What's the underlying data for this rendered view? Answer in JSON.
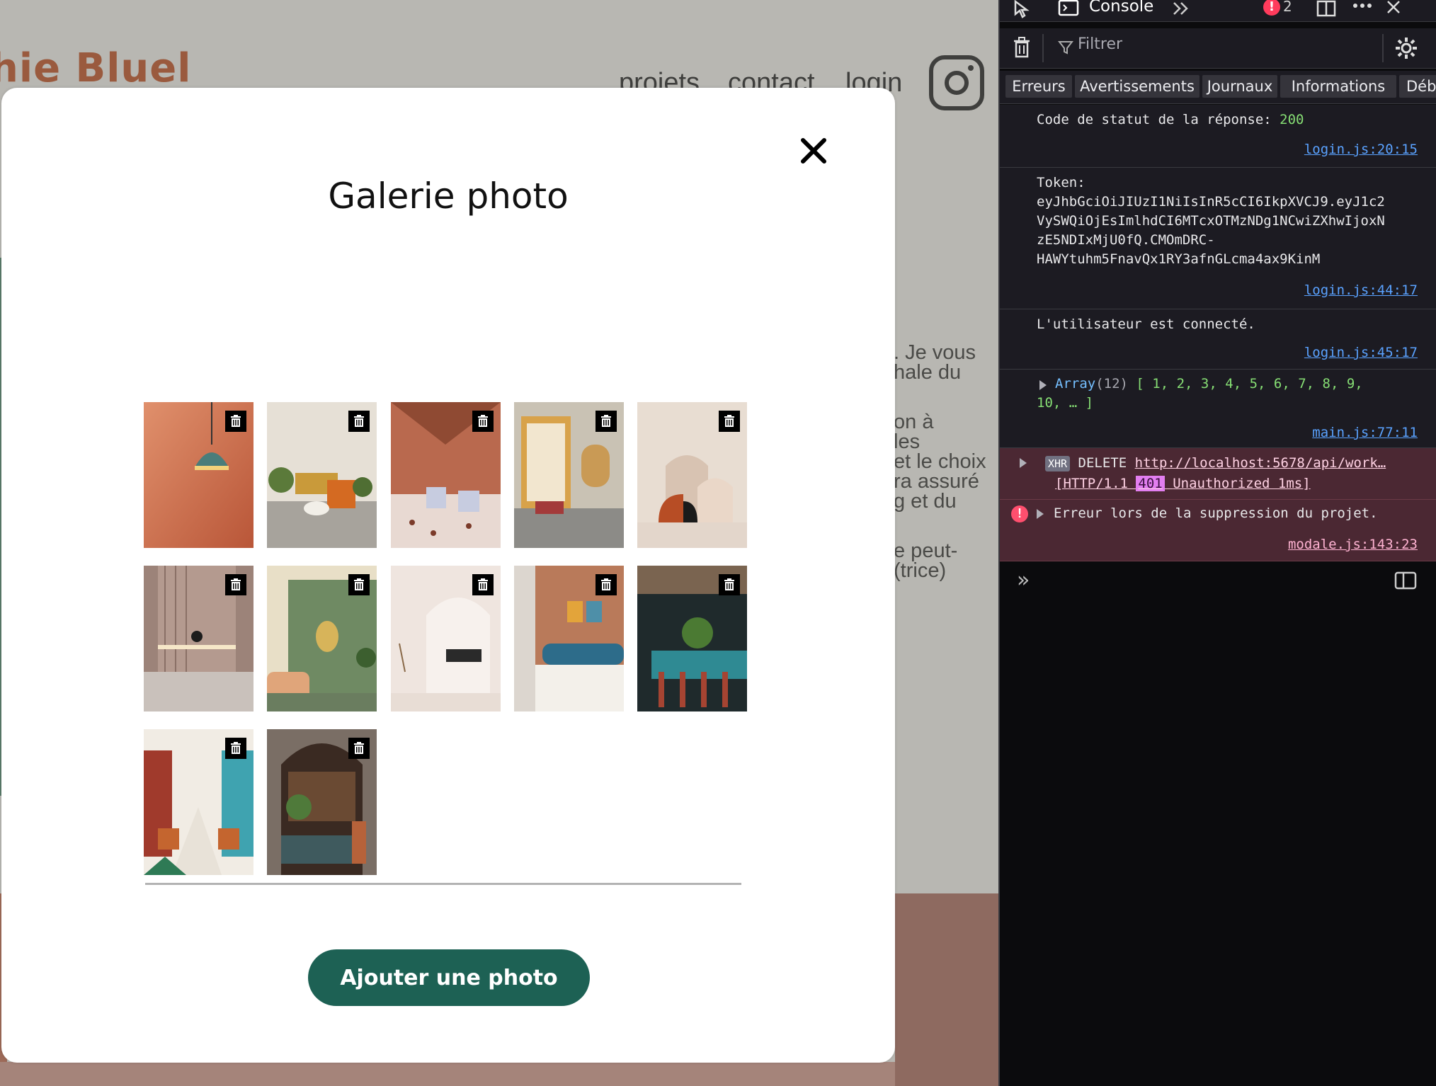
{
  "site": {
    "logo": "hie Bluel",
    "nav": [
      "projets",
      "contact",
      "login"
    ],
    "body_text_lines": [
      ". Je vous",
      "hale du",
      "",
      "on à",
      "les",
      "et le choix",
      "ra assuré",
      "g et du",
      "",
      "e peut-",
      "(trice)"
    ]
  },
  "modal": {
    "title": "Galerie photo",
    "add_button_label": "Ajouter une photo",
    "photos": [
      {
        "alt": "pendant lamp"
      },
      {
        "alt": "living room"
      },
      {
        "alt": "restaurant"
      },
      {
        "alt": "wooden screen"
      },
      {
        "alt": "arches"
      },
      {
        "alt": "kitchen"
      },
      {
        "alt": "green room"
      },
      {
        "alt": "white arch"
      },
      {
        "alt": "bedroom"
      },
      {
        "alt": "bar"
      },
      {
        "alt": "dining hall"
      },
      {
        "alt": "cafe"
      }
    ]
  },
  "devtools": {
    "active_tab": "Console",
    "error_count": "2",
    "filter_placeholder": "Filtrer",
    "tabs": [
      "Erreurs",
      "Avertissements",
      "Journaux",
      "Informations",
      "Déb"
    ],
    "logs": [
      {
        "label": "Code de statut de la réponse: ",
        "value": "200",
        "source": "login.js:20:15"
      },
      {
        "label": "Token:",
        "lines": [
          "eyJhbGciOiJIUzI1NiIsInR5cCI6IkpXVCJ9.eyJ1c2",
          "VySWQiOjEsImlhdCI6MTcxOTMzNDg1NCwiZXhwIjoxN",
          "zE5NDIxMjU0fQ.CMOmDRC-",
          "HAWYtuhm5FnavQx1RY3afnGLcma4ax9KinM"
        ],
        "source": "login.js:44:17"
      },
      {
        "label": "L'utilisateur est connecté.",
        "source": "login.js:45:17"
      },
      {
        "array_label": "Array",
        "array_count": "(12)",
        "array_values": "[ 1, 2, 3, 4, 5, 6, 7, 8, 9,",
        "array_values2": "10, … ]",
        "source": "main.js:77:11"
      },
      {
        "xhr": "XHR",
        "method": "DELETE",
        "url": "http://localhost:5678/api/work…",
        "protocol": "[HTTP/1.1",
        "status": "401",
        "status_text": "Unauthorized 1ms]"
      },
      {
        "message": "Erreur lors de la suppression du projet.",
        "source": "modale.js:143:23"
      }
    ]
  }
}
